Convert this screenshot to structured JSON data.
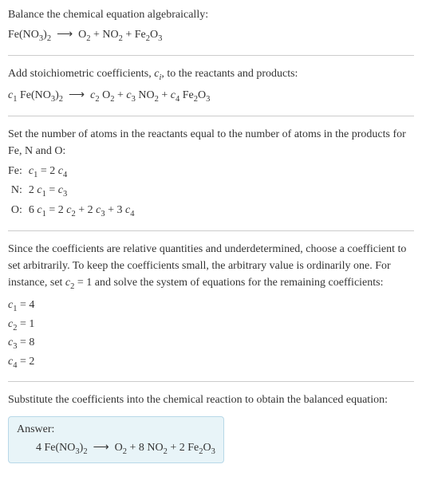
{
  "section1": {
    "line1": "Balance the chemical equation algebraically:",
    "eq": "Fe(NO₃)₂ ⟶ O₂ + NO₂ + Fe₂O₃"
  },
  "section2": {
    "line1_a": "Add stoichiometric coefficients, ",
    "line1_b": ", to the reactants and products:",
    "ci": "c",
    "ci_sub": "i",
    "c1": "c₁",
    "c2": "c₂",
    "c3": "c₃",
    "c4": "c₄",
    "r1": "Fe(NO₃)₂",
    "arrow": "⟶",
    "p1": "O₂",
    "p2": "NO₂",
    "p3": "Fe₂O₃",
    "plus": " + "
  },
  "section3": {
    "line1": "Set the number of atoms in the reactants equal to the number of atoms in the products for Fe, N and O:",
    "rows": [
      {
        "label": "Fe:",
        "eq": "c₁ = 2 c₄"
      },
      {
        "label": "N:",
        "eq": "2 c₁ = c₃"
      },
      {
        "label": "O:",
        "eq": "6 c₁ = 2 c₂ + 2 c₃ + 3 c₄"
      }
    ]
  },
  "section4": {
    "text": "Since the coefficients are relative quantities and underdetermined, choose a coefficient to set arbitrarily. To keep the coefficients small, the arbitrary value is ordinarily one. For instance, set c₂ = 1 and solve the system of equations for the remaining coefficients:",
    "coefs": [
      "c₁ = 4",
      "c₂ = 1",
      "c₃ = 8",
      "c₄ = 2"
    ]
  },
  "section5": {
    "text": "Substitute the coefficients into the chemical reaction to obtain the balanced equation:",
    "answer_label": "Answer:",
    "answer_eq": "4 Fe(NO₃)₂ ⟶ O₂ + 8 NO₂ + 2 Fe₂O₃"
  },
  "chart_data": {
    "type": "table",
    "title": "Chemical equation balancing",
    "unbalanced_equation": "Fe(NO3)2 -> O2 + NO2 + Fe2O3",
    "elements": [
      "Fe",
      "N",
      "O"
    ],
    "atom_balance_equations": [
      {
        "element": "Fe",
        "equation": "c1 = 2*c4"
      },
      {
        "element": "N",
        "equation": "2*c1 = c3"
      },
      {
        "element": "O",
        "equation": "6*c1 = 2*c2 + 2*c3 + 3*c4"
      }
    ],
    "coefficients": {
      "c1": 4,
      "c2": 1,
      "c3": 8,
      "c4": 2
    },
    "balanced_equation": "4 Fe(NO3)2 -> O2 + 8 NO2 + 2 Fe2O3"
  }
}
